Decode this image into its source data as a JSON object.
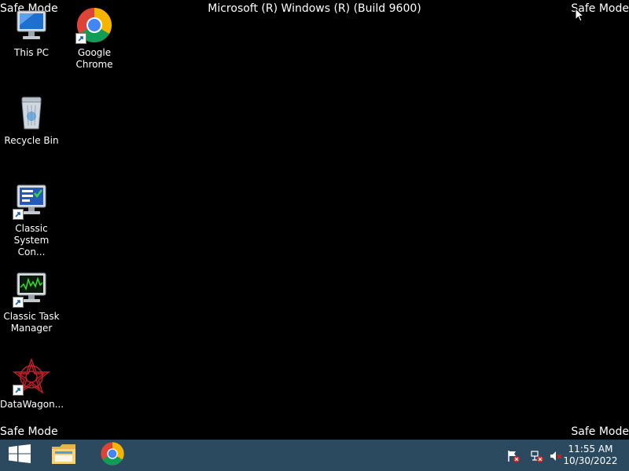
{
  "overlay": {
    "safe_mode_text": "Safe Mode",
    "build_title": "Microsoft (R) Windows (R) (Build 9600)"
  },
  "desktop": {
    "icons": [
      {
        "name": "This PC",
        "line1": "This PC",
        "line2": "",
        "icon": "computer-icon"
      },
      {
        "name": "Google Chrome",
        "line1": "Google",
        "line2": "Chrome",
        "icon": "chrome-icon"
      },
      {
        "name": "Recycle Bin",
        "line1": "Recycle Bin",
        "line2": "",
        "icon": "recycle-bin-icon"
      },
      {
        "name": "Classic System Configuration",
        "line1": "Classic",
        "line2": "System Con...",
        "icon": "system-config-icon"
      },
      {
        "name": "Classic Task Manager",
        "line1": "Classic Task",
        "line2": "Manager",
        "icon": "task-manager-icon"
      },
      {
        "name": "DataWagon",
        "line1": "DataWagon...",
        "line2": "",
        "icon": "datawagon-icon"
      }
    ]
  },
  "taskbar": {
    "start_icon": "windows-logo-icon",
    "pinned": [
      "file-explorer-icon",
      "chrome-icon"
    ],
    "tray": [
      "action-center-flag-icon",
      "network-icon",
      "volume-muted-icon"
    ],
    "clock": {
      "time": "11:55 AM",
      "date": "10/30/2022"
    }
  },
  "colors": {
    "desktop_background": "#000000",
    "taskbar_background": "#2b4a60",
    "text": "#ffffff"
  }
}
